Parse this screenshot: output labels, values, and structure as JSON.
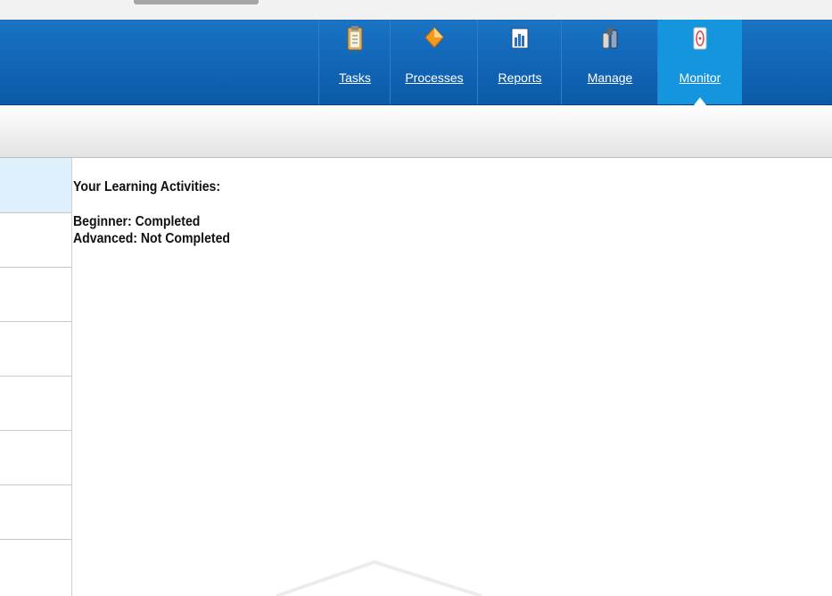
{
  "nav": {
    "items": [
      {
        "label": "Tasks",
        "icon": "clipboard-icon"
      },
      {
        "label": "Processes",
        "icon": "process-diamond-icon"
      },
      {
        "label": "Reports",
        "icon": "report-chart-icon"
      },
      {
        "label": "Manage",
        "icon": "manage-icon"
      },
      {
        "label": "Monitor",
        "icon": "monitor-icon"
      }
    ],
    "active": "Monitor",
    "colors": {
      "bar": "#0b5aa8",
      "active": "#1495de"
    }
  },
  "main": {
    "heading": "Your Learning Activities:",
    "activities": [
      {
        "text": "Beginner: Completed"
      },
      {
        "text": "Advanced: Not Completed"
      }
    ]
  }
}
